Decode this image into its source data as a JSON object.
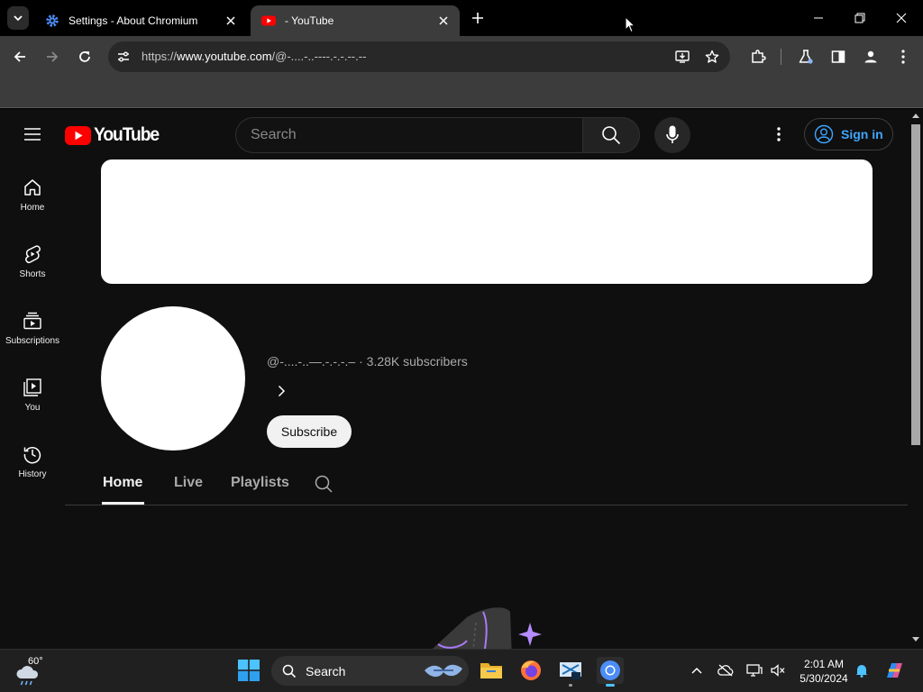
{
  "browser": {
    "tabs": [
      {
        "title": "Settings - About Chromium",
        "active": false,
        "icon": "gear-icon"
      },
      {
        "title": "- YouTube",
        "active": true,
        "icon": "youtube-icon"
      }
    ],
    "url_prefix": "https://",
    "url_host": "www.youtube.com",
    "url_path": "/@-....-..----.-.-.--.--"
  },
  "youtube": {
    "logo_text": "YouTube",
    "search_placeholder": "Search",
    "sign_in_label": "Sign in",
    "nav": [
      {
        "label": "Home",
        "icon": "home-icon"
      },
      {
        "label": "Shorts",
        "icon": "shorts-icon"
      },
      {
        "label": "Subscriptions",
        "icon": "subscriptions-icon"
      },
      {
        "label": "You",
        "icon": "you-icon"
      },
      {
        "label": "History",
        "icon": "history-icon"
      }
    ],
    "channel": {
      "handle": "@-....-..—.-.-.-.–",
      "subscribers": "3.28K subscribers",
      "subscribe_label": "Subscribe"
    },
    "channel_tabs": [
      {
        "label": "Home",
        "active": true
      },
      {
        "label": "Live",
        "active": false
      },
      {
        "label": "Playlists",
        "active": false
      }
    ]
  },
  "taskbar": {
    "weather_temp": "60°",
    "search_label": "Search",
    "time": "2:01 AM",
    "date": "5/30/2024",
    "apps": [
      "file-explorer-icon",
      "firefox-icon",
      "snipping-tool-icon",
      "chromium-icon"
    ]
  },
  "colors": {
    "youtube_red": "#ff0000",
    "link_blue": "#3ea6ff",
    "page_bg": "#0f0f0f",
    "chrome_bg": "#3c3c3c"
  }
}
